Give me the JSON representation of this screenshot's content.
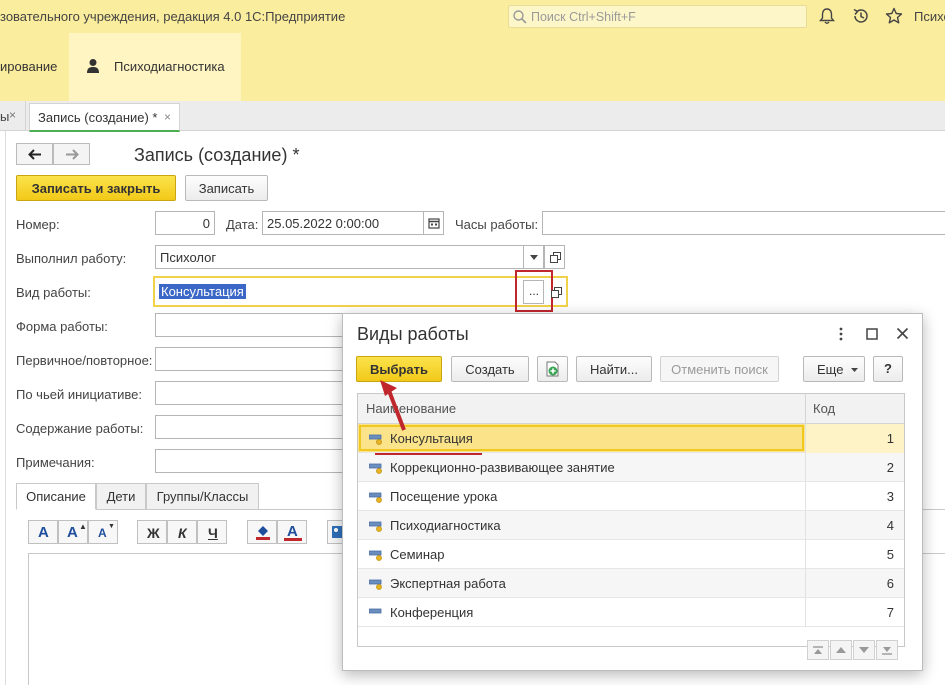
{
  "titlebar": {
    "title": "зовательного учреждения, редакция 4.0 1С:Предприятие",
    "search_placeholder": "Поиск Ctrl+Shift+F",
    "user": "Психо"
  },
  "sections": {
    "items": [
      {
        "label": "ирование"
      },
      {
        "label": "Психодиагностика"
      }
    ]
  },
  "tabs": {
    "prev_label": "ы",
    "prev_close": "×",
    "active_label": "Запись (создание) *",
    "active_close": "×"
  },
  "form": {
    "title": "Запись (создание) *",
    "save_close_label": "Записать и закрыть",
    "save_label": "Записать",
    "number": {
      "label": "Номер:",
      "value": "0"
    },
    "date": {
      "label": "Дата:",
      "value": "25.05.2022  0:00:00"
    },
    "hours": {
      "label": "Часы работы:",
      "value": ""
    },
    "performer": {
      "label": "Выполнил работу:",
      "value": "Психолог"
    },
    "work_type": {
      "label": "Вид работы:",
      "value": "Консультация",
      "select_button": "..."
    },
    "work_form": {
      "label": "Форма работы:"
    },
    "primary": {
      "label": "Первичное/повторное:"
    },
    "initiative": {
      "label": "По чьей инициативе:"
    },
    "content": {
      "label": "Содержание работы:"
    },
    "notes": {
      "label": "Примечания:"
    },
    "bottom_tabs": [
      "Описание",
      "Дети",
      "Группы/Классы"
    ],
    "format_buttons": [
      "A",
      "A",
      "A",
      "Ж",
      "К",
      "Ч",
      "A"
    ]
  },
  "dialog": {
    "title": "Виды работы",
    "select_label": "Выбрать",
    "create_label": "Создать",
    "find_label": "Найти...",
    "cancel_search_label": "Отменить поиск",
    "more_label": "Еще",
    "help_label": "?",
    "columns": {
      "name": "Наименование",
      "code": "Код"
    },
    "rows": [
      {
        "name": "Консультация",
        "code": "1"
      },
      {
        "name": "Коррекционно-развивающее занятие",
        "code": "2"
      },
      {
        "name": "Посещение урока",
        "code": "3"
      },
      {
        "name": "Психодиагностика",
        "code": "4"
      },
      {
        "name": "Семинар",
        "code": "5"
      },
      {
        "name": "Экспертная работа",
        "code": "6"
      },
      {
        "name": "Конференция",
        "code": "7"
      }
    ],
    "selected_row": 0
  },
  "colors": {
    "titlebar_bg": "#fbed9e",
    "accent_yellow": "#f2c918",
    "selection": "#fbe38a",
    "highlight_red": "#c0272d"
  }
}
